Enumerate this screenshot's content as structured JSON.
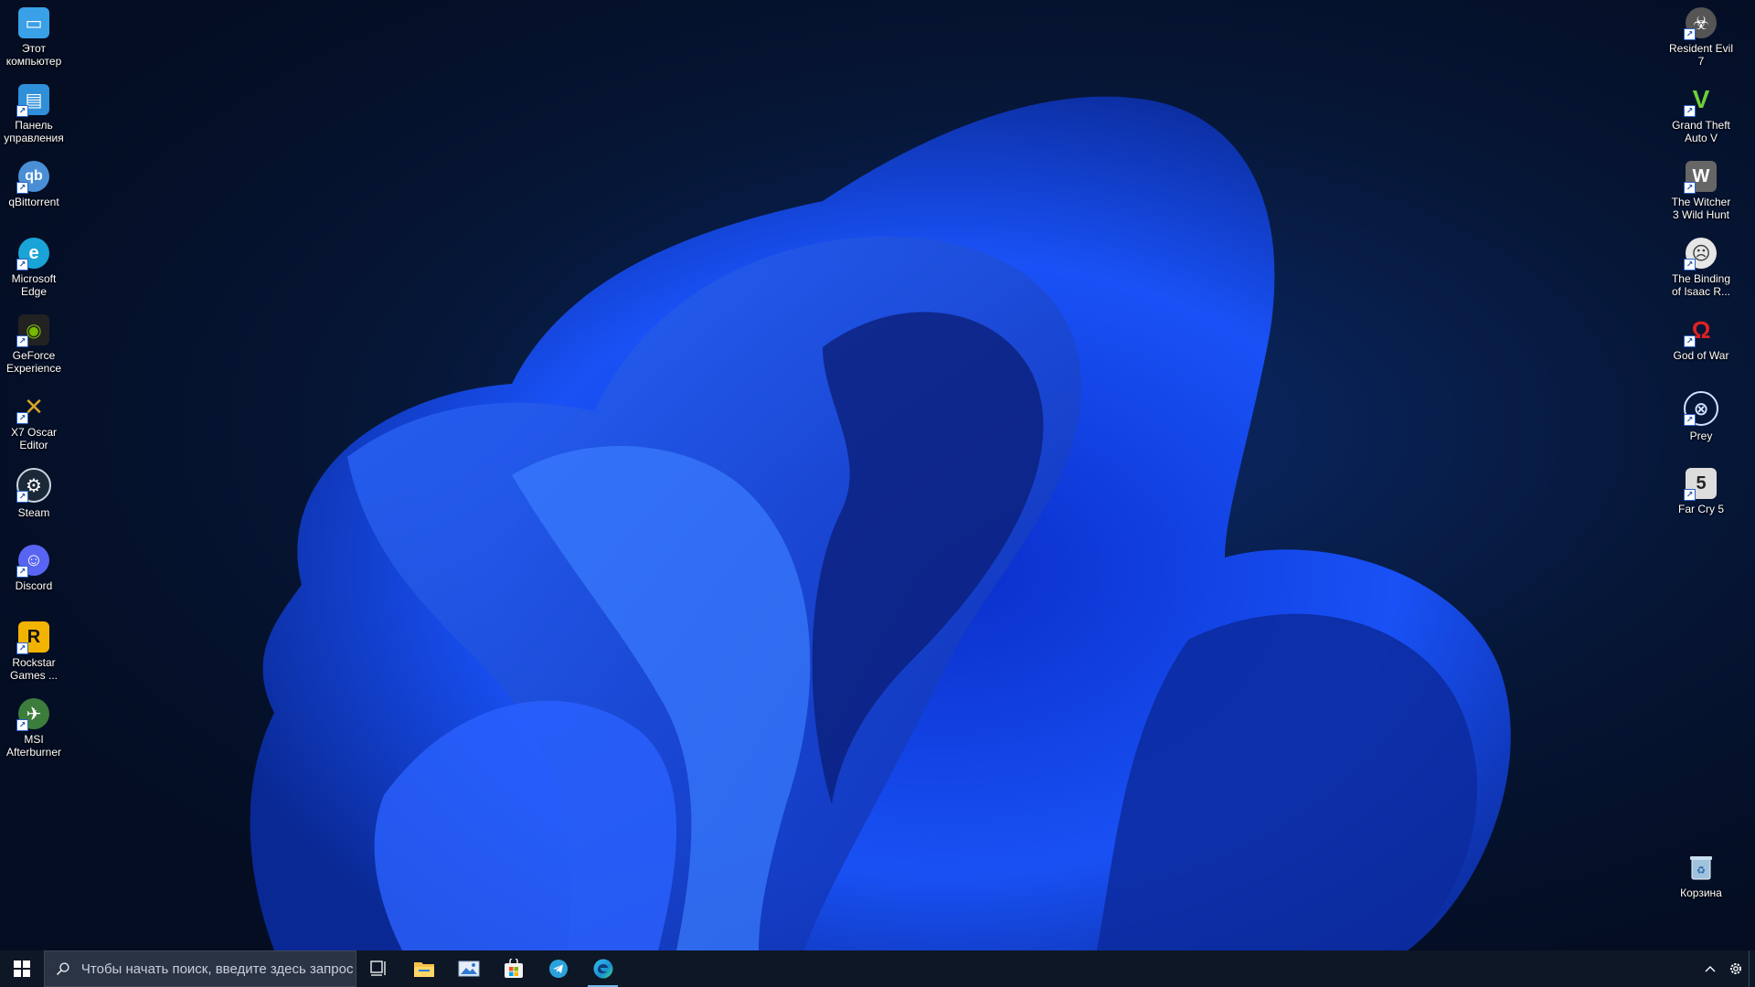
{
  "desktop": {
    "left_icons": [
      {
        "label": "Этот компьютер",
        "icon": "this-pc-icon",
        "color": "#3aa0e8"
      },
      {
        "label": "Панель управления",
        "icon": "control-panel-icon",
        "color": "#2f8fd8"
      },
      {
        "label": "qBittorrent",
        "icon": "qbittorrent-icon",
        "color": "#4a8fd6"
      },
      {
        "label": "Microsoft Edge",
        "icon": "edge-icon",
        "color": "#1aa3d6"
      },
      {
        "label": "GeForce Experience",
        "icon": "geforce-icon",
        "color": "#76b900"
      },
      {
        "label": "X7 Oscar Editor",
        "icon": "x7-oscar-icon",
        "color": "#d9a22a"
      },
      {
        "label": "Steam",
        "icon": "steam-icon",
        "color": "#1b2838"
      },
      {
        "label": "Discord",
        "icon": "discord-icon",
        "color": "#5865f2"
      },
      {
        "label": "Rockstar Games ...",
        "icon": "rockstar-icon",
        "color": "#f2b300"
      },
      {
        "label": "MSI Afterburner",
        "icon": "msi-afterburner-icon",
        "color": "#3c7d3c"
      }
    ],
    "right_icons": [
      {
        "label": "Resident Evil 7",
        "icon": "resident-evil-icon",
        "color": "#8a8a8a"
      },
      {
        "label": "Grand Theft Auto V",
        "icon": "gta-v-icon",
        "color": "#2c7a2c"
      },
      {
        "label": "The Witcher 3 Wild Hunt",
        "icon": "witcher-icon",
        "color": "#8c8c8c"
      },
      {
        "label": "The Binding of Isaac R...",
        "icon": "isaac-icon",
        "color": "#d9d9d9"
      },
      {
        "label": "God of War",
        "icon": "god-of-war-icon",
        "color": "#b32020"
      },
      {
        "label": "Prey",
        "icon": "prey-icon",
        "color": "#3a6ea8"
      },
      {
        "label": "Far Cry 5",
        "icon": "far-cry-5-icon",
        "color": "#c8c8c8"
      }
    ],
    "recycle_bin": {
      "label": "Корзина",
      "icon": "recycle-bin-icon",
      "color": "#7aa7c7"
    }
  },
  "taskbar": {
    "search_placeholder": "Чтобы начать поиск, введите здесь запрос",
    "pinned": [
      {
        "name": "task-view",
        "icon": "task-view-icon"
      },
      {
        "name": "file-explorer",
        "icon": "folder-icon"
      },
      {
        "name": "photos",
        "icon": "photos-icon"
      },
      {
        "name": "microsoft-store",
        "icon": "store-icon"
      },
      {
        "name": "telegram",
        "icon": "telegram-icon"
      },
      {
        "name": "edge",
        "icon": "edge-icon",
        "active": true
      }
    ]
  },
  "colors": {
    "taskbar_bg": "#0e1726",
    "accent": "#76b9ed",
    "wallpaper_bloom": "#1a4cff"
  }
}
